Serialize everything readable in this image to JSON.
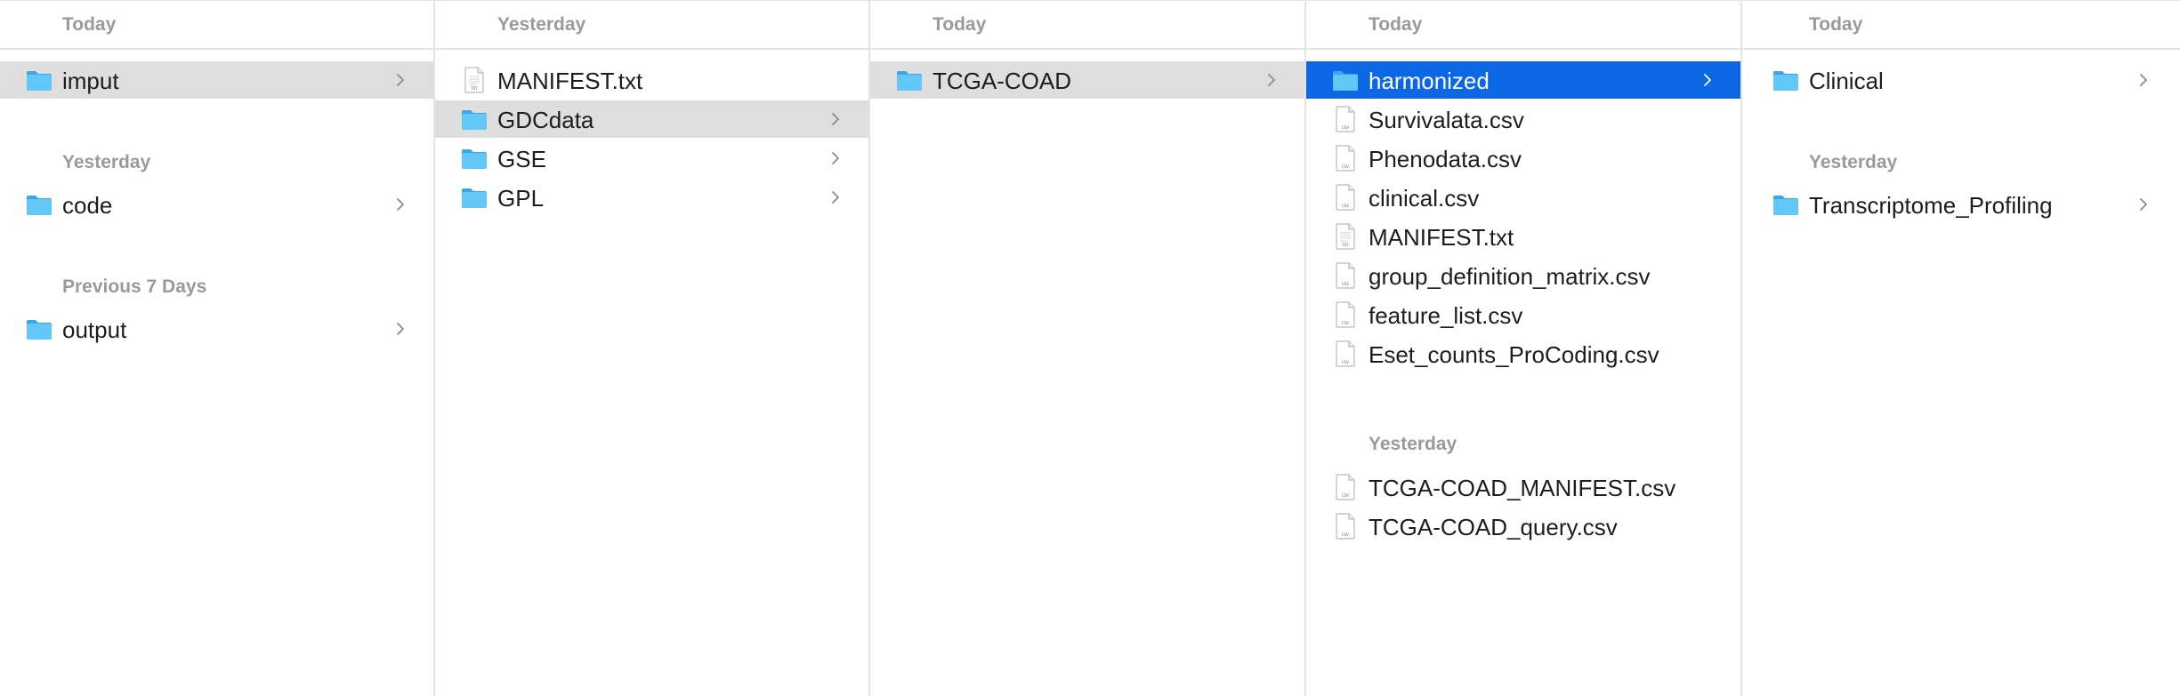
{
  "columns": [
    {
      "header": "Today",
      "rows": [
        {
          "label": "imput",
          "kind": "folder",
          "chevron": true,
          "selected": "gray"
        }
      ],
      "sections": [
        {
          "title": "Yesterday",
          "rows": [
            {
              "label": "code",
              "kind": "folder",
              "chevron": true
            }
          ]
        },
        {
          "title": "Previous 7 Days",
          "rows": [
            {
              "label": "output",
              "kind": "folder",
              "chevron": true
            }
          ]
        }
      ]
    },
    {
      "header": "Yesterday",
      "rows": [
        {
          "label": "MANIFEST.txt",
          "kind": "txt-file"
        },
        {
          "label": "GDCdata",
          "kind": "folder",
          "chevron": true,
          "selected": "gray"
        },
        {
          "label": "GSE",
          "kind": "folder",
          "chevron": true
        },
        {
          "label": "GPL",
          "kind": "folder",
          "chevron": true
        }
      ]
    },
    {
      "header": "Today",
      "rows": [
        {
          "label": "TCGA-COAD",
          "kind": "folder",
          "chevron": true,
          "selected": "gray"
        }
      ]
    },
    {
      "header": "Today",
      "rows": [
        {
          "label": "harmonized",
          "kind": "folder",
          "chevron": true,
          "selected": "blue"
        },
        {
          "label": "Survivalata.csv",
          "kind": "csv-file"
        },
        {
          "label": "Phenodata.csv",
          "kind": "csv-file"
        },
        {
          "label": "clinical.csv",
          "kind": "csv-file"
        },
        {
          "label": "MANIFEST.txt",
          "kind": "txt-file"
        },
        {
          "label": "group_definition_matrix.csv",
          "kind": "csv-file"
        },
        {
          "label": "feature_list.csv",
          "kind": "csv-file"
        },
        {
          "label": "Eset_counts_ProCoding.csv",
          "kind": "csv-file"
        }
      ],
      "sections": [
        {
          "title": "Yesterday",
          "rows": [
            {
              "label": "TCGA-COAD_MANIFEST.csv",
              "kind": "csv-file"
            },
            {
              "label": "TCGA-COAD_query.csv",
              "kind": "csv-file"
            }
          ]
        }
      ]
    },
    {
      "header": "Today",
      "rows": [
        {
          "label": "Clinical",
          "kind": "folder",
          "chevron": true
        }
      ],
      "sections": [
        {
          "title": "Yesterday",
          "rows": [
            {
              "label": "Transcriptome_Profiling",
              "kind": "folder",
              "chevron": true
            }
          ]
        }
      ]
    }
  ],
  "colors": {
    "selection_blue": "#0b67e4",
    "selection_gray": "#dedede",
    "folder_blue": "#5ac4f5",
    "section_title_gray": "#9a9a9a"
  }
}
